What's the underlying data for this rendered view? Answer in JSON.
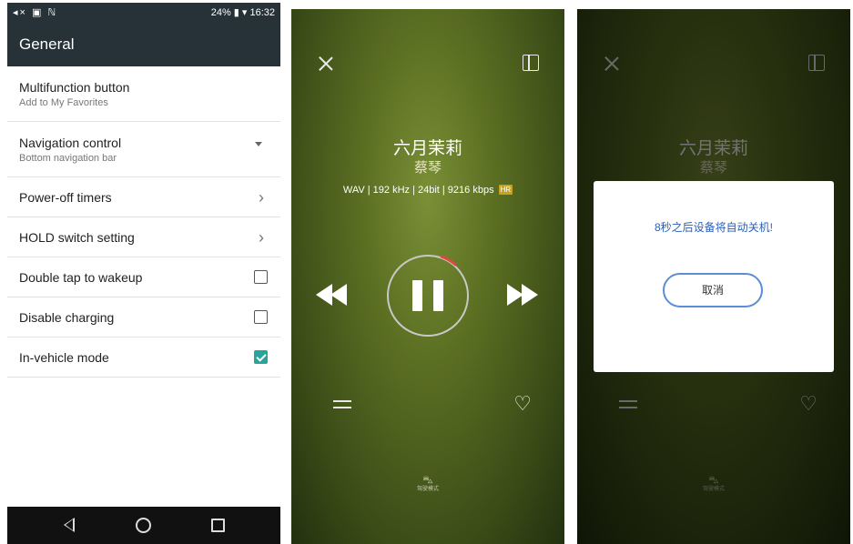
{
  "settings": {
    "status_left": "◂× ▣ ℕ",
    "status_right": "24% ▮ ▾ 16:32",
    "title": "General",
    "rows": [
      {
        "label": "Multifunction button",
        "sub": "Add to My Favorites",
        "control": "none"
      },
      {
        "label": "Navigation control",
        "sub": "Bottom navigation bar",
        "control": "dropdown"
      },
      {
        "label": "Power-off timers",
        "control": "chevron"
      },
      {
        "label": "HOLD switch setting",
        "control": "chevron"
      },
      {
        "label": "Double tap to wakeup",
        "control": "checkbox",
        "checked": false
      },
      {
        "label": "Disable charging",
        "control": "checkbox",
        "checked": false
      },
      {
        "label": "In-vehicle mode",
        "control": "checkbox",
        "checked": true
      }
    ],
    "chevron_glyph": "›",
    "nav": {
      "back_icon": "back-triangle",
      "home_icon": "home-circle",
      "recent_icon": "recent-square"
    },
    "accent_color": "#26a69a",
    "bar_color": "#263238"
  },
  "player": {
    "song_title": "六月茉莉",
    "artist": "蔡琴",
    "format": "WAV | 192 kHz | 24bit | 9216 kbps",
    "hr_badge": "HR",
    "heart_glyph": "♡",
    "car_icon_glyph": "⛍",
    "car_mode_label": "驾驶模式",
    "progress_accent": "#e0483c"
  },
  "dialog": {
    "message": "8秒之后设备将自动关机!",
    "cancel": "取消"
  }
}
